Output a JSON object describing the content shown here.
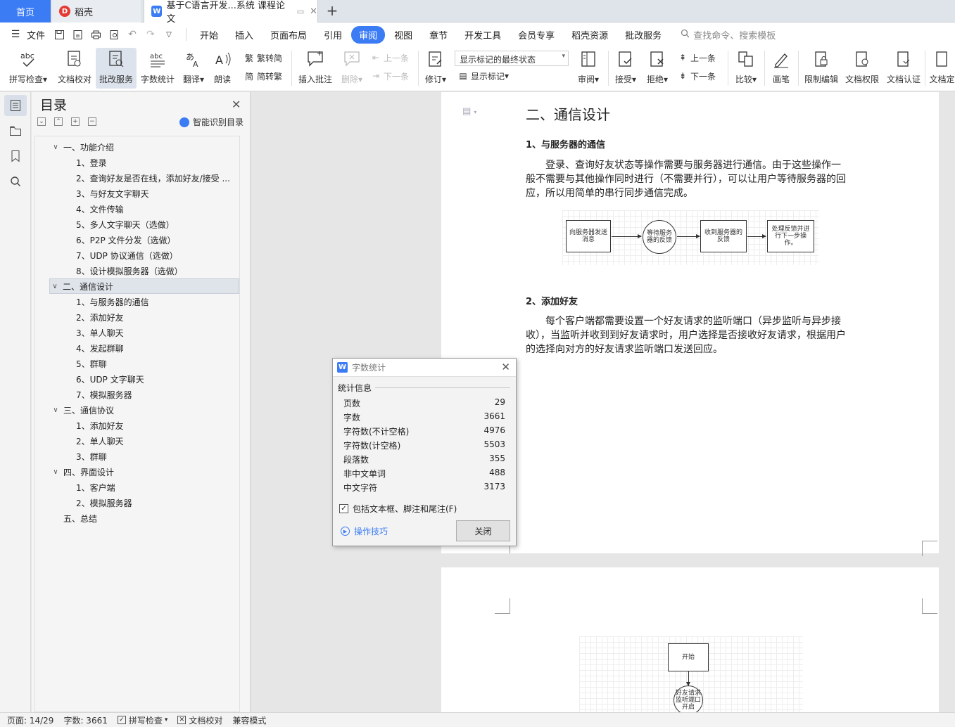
{
  "tabs": {
    "home": "首页",
    "daoke": "稻壳",
    "document": "基于C语言开发...系统 课程论文"
  },
  "menu": {
    "file": "文件",
    "items": [
      "开始",
      "插入",
      "页面布局",
      "引用",
      "审阅",
      "视图",
      "章节",
      "开发工具",
      "会员专享",
      "稻壳资源",
      "批改服务"
    ],
    "active_index": 4,
    "search_placeholder": "查找命令、搜索模板"
  },
  "ribbon": {
    "spell_check": "拼写检查",
    "doc_proofread": "文档校对",
    "correction_service": "批改服务",
    "word_count": "字数统计",
    "translate": "翻译",
    "read_aloud": "朗读",
    "trad_to_simp": "繁转简",
    "simp_to_trad": "简转繁",
    "insert_comment": "插入批注",
    "delete": "删除",
    "prev_comment": "上一条",
    "next_comment": "下一条",
    "track_changes": "修订",
    "markup_state": "显示标记的最终状态",
    "show_markup": "显示标记",
    "review": "审阅",
    "accept": "接受",
    "reject": "拒绝",
    "prev_change": "上一条",
    "next_change": "下一条",
    "compare": "比较",
    "pen": "画笔",
    "restrict_edit": "限制编辑",
    "doc_permission": "文档权限",
    "doc_certify": "文档认证",
    "doc_final": "文档定"
  },
  "toc": {
    "title": "目录",
    "smart_toc": "智能识别目录",
    "items": [
      {
        "label": "一、功能介绍",
        "level": 1,
        "expanded": true
      },
      {
        "label": "1、登录",
        "level": 2
      },
      {
        "label": "2、查询好友是否在线，添加好友/接受 ...",
        "level": 2
      },
      {
        "label": "3、与好友文字聊天",
        "level": 2
      },
      {
        "label": "4、文件传输",
        "level": 2
      },
      {
        "label": "5、多人文字聊天（选做）",
        "level": 2
      },
      {
        "label": "6、P2P 文件分发（选做）",
        "level": 2
      },
      {
        "label": "7、UDP 协议通信（选做）",
        "level": 2
      },
      {
        "label": "8、设计模拟服务器（选做）",
        "level": 2
      },
      {
        "label": "二、通信设计",
        "level": 1,
        "expanded": true,
        "selected": true
      },
      {
        "label": "1、与服务器的通信",
        "level": 2
      },
      {
        "label": "2、添加好友",
        "level": 2
      },
      {
        "label": "3、单人聊天",
        "level": 2
      },
      {
        "label": "4、发起群聊",
        "level": 2
      },
      {
        "label": "5、群聊",
        "level": 2
      },
      {
        "label": "6、UDP 文字聊天",
        "level": 2
      },
      {
        "label": "7、模拟服务器",
        "level": 2
      },
      {
        "label": "三、通信协议",
        "level": 1,
        "expanded": true
      },
      {
        "label": "1、添加好友",
        "level": 2
      },
      {
        "label": "2、单人聊天",
        "level": 2
      },
      {
        "label": "3、群聊",
        "level": 2
      },
      {
        "label": "四、界面设计",
        "level": 1,
        "expanded": true
      },
      {
        "label": "1、客户端",
        "level": 2
      },
      {
        "label": "2、模拟服务器",
        "level": 2
      },
      {
        "label": "五、总结",
        "level": 1,
        "expanded": false
      }
    ]
  },
  "document": {
    "heading": "二、通信设计",
    "section1_title": "1、与服务器的通信",
    "section1_para": "登录、查询好友状态等操作需要与服务器进行通信。由于这些操作一般不需要与其他操作同时进行（不需要并行），可以让用户等待服务器的回应，所以用简单的串行同步通信完成。",
    "flow1": {
      "step1": "向服务器发送消息",
      "step2": "等待服务器的反馈",
      "step3": "收到服务器的反馈",
      "step4": "处理反馈并进行下一步操作。"
    },
    "section2_title": "2、添加好友",
    "section2_para": "每个客户端都需要设置一个好友请求的监听端口（异步监听与异步接收），当监听并收到到好友请求时，用户选择是否接收好友请求，根据用户的选择向对方的好友请求监听端口发送回应。",
    "flow2": {
      "start": "开始",
      "step2": "好友请求监听端口开启"
    }
  },
  "dialog": {
    "title": "字数统计",
    "section": "统计信息",
    "stats": [
      {
        "label": "页数",
        "value": "29"
      },
      {
        "label": "字数",
        "value": "3661"
      },
      {
        "label": "字符数(不计空格)",
        "value": "4976"
      },
      {
        "label": "字符数(计空格)",
        "value": "5503"
      },
      {
        "label": "段落数",
        "value": "355"
      },
      {
        "label": "非中文单词",
        "value": "488"
      },
      {
        "label": "中文字符",
        "value": "3173"
      }
    ],
    "include_label": "包括文本框、脚注和尾注(F)",
    "include_checked": true,
    "tips": "操作技巧",
    "close_button": "关闭"
  },
  "status": {
    "page": "页面: 14/29",
    "words": "字数: 3661",
    "spell_check": "拼写检查",
    "doc_proofread": "文档校对",
    "compat_mode": "兼容模式"
  },
  "colors": {
    "accent": "#3b7cf5",
    "selected_bg": "#dfe3ea"
  }
}
